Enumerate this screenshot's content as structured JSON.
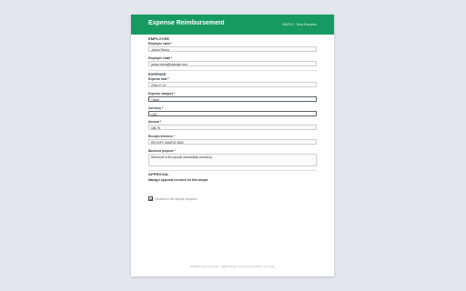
{
  "header": {
    "title": "Expense Reimbursement",
    "tag": "SAMPLE · Nova Examples"
  },
  "employee": {
    "section_title": "EMPLOYEE",
    "name_label": "Employee name *",
    "name_value": "Jordan Rivera",
    "email_label": "Employee email *",
    "email_value": "jordan.rivera@example.com"
  },
  "expense": {
    "section_title": "EXPENSE",
    "date_label": "Expense date *",
    "date_value": "2026-07-14",
    "category_label": "Expense category *",
    "category_value": "Travel",
    "currency_label": "Currency *",
    "currency_value": "CAD",
    "amount_label": "Amount *",
    "amount_value": "186.75",
    "receipt_label": "Receipt reference *",
    "receipt_value": "RECEIPT-SAMPLE-9060",
    "purpose_label": "Business purpose *",
    "purpose_value": "Rail travel to the sample accessibility workshop."
  },
  "approval": {
    "section_title": "APPROVAL",
    "manager_label": "Manager approval recorded for this sample",
    "checkbox_text": "Checked in the sample response",
    "checked": true
  },
  "footer": {
    "text": "SAMPLE form test only · fillable simply, forming a consistent re-render"
  }
}
